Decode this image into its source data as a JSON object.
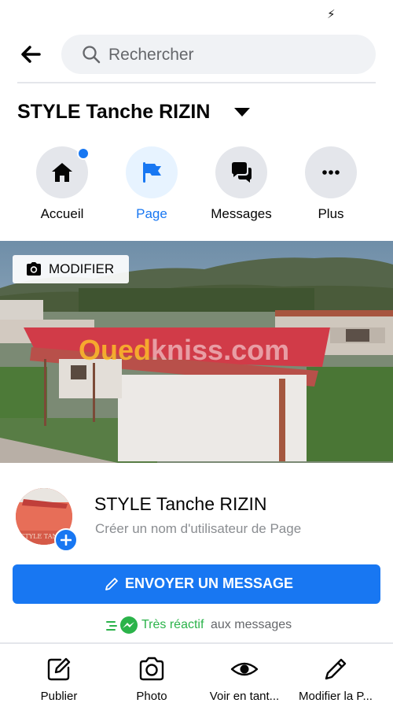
{
  "status_bar": {
    "icon": "charging-bolt-icon",
    "glyph": "⚡"
  },
  "header": {
    "back_icon": "back-arrow-icon",
    "search_placeholder": "Rechercher"
  },
  "page": {
    "title": "STYLE Tanche RIZIN"
  },
  "nav": [
    {
      "label": "Accueil",
      "icon": "home-icon",
      "active": false,
      "notification_dot": true
    },
    {
      "label": "Page",
      "icon": "flag-icon",
      "active": true
    },
    {
      "label": "Messages",
      "icon": "messages-icon",
      "active": false
    },
    {
      "label": "Plus",
      "icon": "more-icon",
      "active": false
    }
  ],
  "cover": {
    "edit_label": "MODIFIER",
    "watermark": {
      "part1": "Oued",
      "part2": "kniss.com"
    }
  },
  "profile": {
    "name": "STYLE Tanche RIZIN",
    "username_prompt": "Créer un nom d'utilisateur de Page",
    "avatar_text": "STYLE TAN"
  },
  "send_message": {
    "label": "ENVOYER UN MESSAGE"
  },
  "responsiveness": {
    "highlight": "Très réactif",
    "rest": "aux messages"
  },
  "actions": [
    {
      "label": "Publier",
      "icon": "edit-post-icon"
    },
    {
      "label": "Photo",
      "icon": "camera-icon"
    },
    {
      "label": "Voir en tant...",
      "icon": "eye-icon"
    },
    {
      "label": "Modifier la P...",
      "icon": "pencil-icon"
    }
  ],
  "colors": {
    "accent": "#1877f2",
    "responsive_green": "#2bb34a",
    "muted": "#65676b"
  }
}
